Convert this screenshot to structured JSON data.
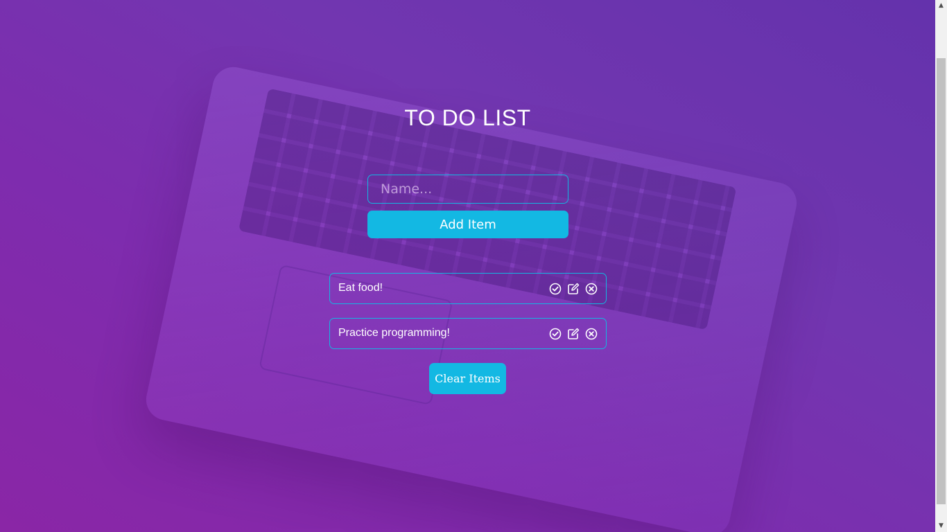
{
  "page": {
    "title": "TO DO LIST"
  },
  "form": {
    "placeholder": "Name...",
    "value": "",
    "add_label": "Add Item"
  },
  "items": [
    {
      "text": "Eat food!",
      "icons": [
        "check-circle-icon",
        "edit-icon",
        "close-circle-icon"
      ]
    },
    {
      "text": "Practice programming!",
      "icons": [
        "check-circle-icon",
        "edit-icon",
        "close-circle-icon"
      ]
    }
  ],
  "clear_label": "Clear Items",
  "colors": {
    "accent": "#13b8e3",
    "background": "#7a2cae",
    "text": "#ffffff"
  }
}
